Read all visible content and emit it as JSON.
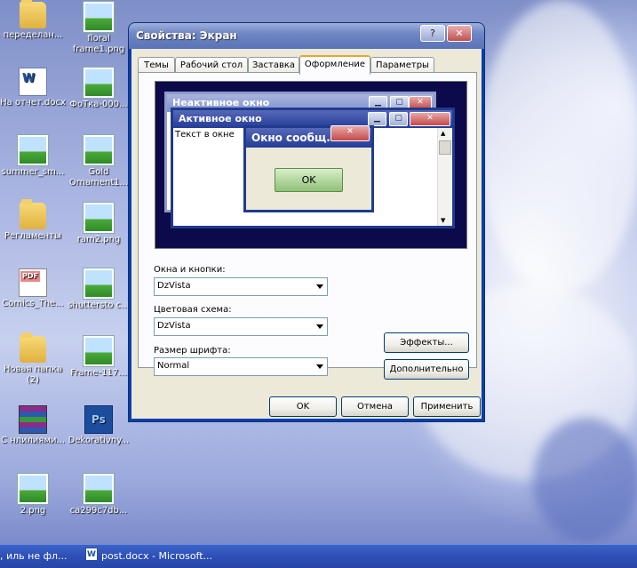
{
  "desktop": {
    "icons": [
      {
        "label": "переделан...",
        "type": "folder"
      },
      {
        "label": "floral frame1.png",
        "type": "image"
      },
      {
        "label": "На отчет.docx",
        "type": "word"
      },
      {
        "label": "ФоТка-000...",
        "type": "image"
      },
      {
        "label": "summer_sm...",
        "type": "image"
      },
      {
        "label": "Gold Ornament1...",
        "type": "image"
      },
      {
        "label": "Регламенты",
        "type": "folder"
      },
      {
        "label": "ram2.png",
        "type": "image"
      },
      {
        "label": "Comics_The...",
        "type": "pdf"
      },
      {
        "label": "shuttersto c...",
        "type": "image"
      },
      {
        "label": "Новая папка (2)",
        "type": "folder"
      },
      {
        "label": "Frame-117...",
        "type": "image"
      },
      {
        "label": "С нлилиями...",
        "type": "rar"
      },
      {
        "label": "Dekorativny...",
        "type": "psd"
      },
      {
        "label": "2.png",
        "type": "image"
      },
      {
        "label": "ca299c7db...",
        "type": "image"
      }
    ]
  },
  "dialog": {
    "title": "Свойства: Экран",
    "help_btn": "?",
    "close_btn": "✕",
    "tabs": [
      "Темы",
      "Рабочий стол",
      "Заставка",
      "Оформление",
      "Параметры"
    ],
    "active_tab": "Оформление",
    "preview": {
      "inactive_title": "Неактивное окно",
      "active_title": "Активное окно",
      "window_text": "Текст в окне",
      "message_title": "Окно сообщ...",
      "message_ok": "OK"
    },
    "windows_buttons_label": "Окна и кнопки:",
    "windows_buttons_value": "DzVista",
    "color_scheme_label": "Цветовая схема:",
    "color_scheme_value": "DzVista",
    "font_size_label": "Размер шрифта:",
    "font_size_value": "Normal",
    "effects_btn": "Эффекты...",
    "advanced_btn": "Дополнительно",
    "ok_btn": "OK",
    "cancel_btn": "Отмена",
    "apply_btn": "Применить"
  },
  "taskbar": {
    "items": [
      ", иль не фл...",
      "post.docx - Microsoft..."
    ]
  }
}
